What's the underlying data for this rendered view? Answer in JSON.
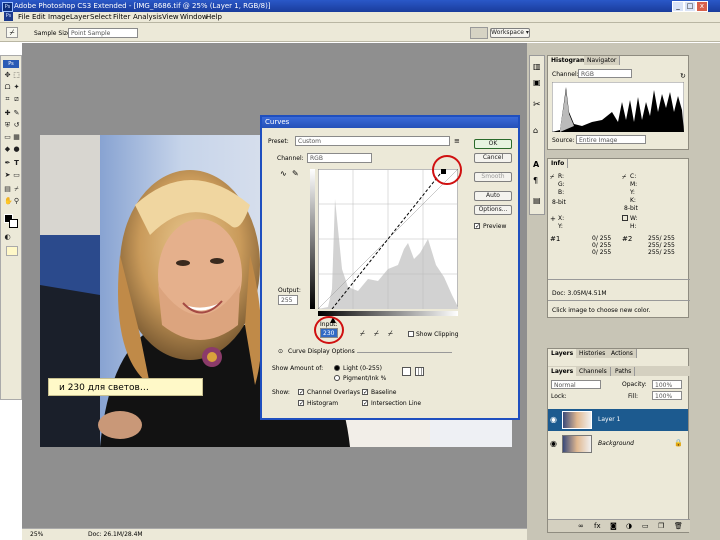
{
  "app": {
    "title": "Adobe Photoshop CS3 Extended - [IMG_8686.tif @ 25% (Layer 1, RGB/8)]",
    "icon_label": "Ps"
  },
  "window_controls": {
    "minimize": "_",
    "maximize": "□",
    "close": "x"
  },
  "menubar": {
    "items": [
      "File",
      "Edit",
      "Image",
      "Layer",
      "Select",
      "Filter",
      "Analysis",
      "View",
      "Window",
      "Help"
    ]
  },
  "options_bar": {
    "sample_size_label": "Sample Size:",
    "sample_size_value": "Point Sample",
    "workspace_label": "Workspace ▾"
  },
  "caption_box": {
    "text": "и 230 для светов…"
  },
  "curves_dialog": {
    "title": "Curves",
    "preset_label": "Preset:",
    "preset_value": "Custom",
    "channel_label": "Channel:",
    "channel_value": "RGB",
    "output_label": "Output:",
    "output_value": "255",
    "input_label": "Input:",
    "input_value": "230",
    "show_clipping_label": "Show Clipping",
    "curve_display_label": "Curve Display Options",
    "show_amount_label": "Show Amount of:",
    "light_option": "Light (0-255)",
    "pigment_option": "Pigment/Ink %",
    "show_label": "Show:",
    "show_items": [
      "Channel Overlays",
      "Baseline",
      "Histogram",
      "Intersection Line"
    ],
    "buttons": {
      "ok": "OK",
      "cancel": "Cancel",
      "smooth": "Smooth",
      "auto": "Auto",
      "options": "Options...",
      "preview": "Preview"
    }
  },
  "histogram_panel": {
    "tabs": [
      "Histogram",
      "Navigator"
    ],
    "channel_label": "Channel:",
    "channel_value": "RGB",
    "source_label": "Source:",
    "source_value": "Entire Image"
  },
  "info_panel": {
    "tab": "Info",
    "rows_left": [
      "R:",
      "G:",
      "B:",
      "8-bit"
    ],
    "rows_right": [
      "C:",
      "M:",
      "Y:",
      "K:",
      "8-bit"
    ],
    "mid_left": [
      "X:",
      "Y:"
    ],
    "mid_right": [
      "W:",
      "H:"
    ],
    "values_a": [
      "0/ 255",
      "0/ 255",
      "0/ 255"
    ],
    "values_b": [
      "255/ 255",
      "255/ 255",
      "255/ 255"
    ],
    "doc_label": "Doc: 3.05M/4.51M",
    "hint": "Click image to choose new color."
  },
  "layers_panel": {
    "tabs": [
      "Layers",
      "Channels",
      "Paths"
    ],
    "panel_tabs": [
      "Layers",
      "Histories",
      "Actions"
    ],
    "blend_mode": "Normal",
    "opacity_label": "Opacity:",
    "opacity_value": "100%",
    "lock_label": "Lock:",
    "fill_label": "Fill:",
    "fill_value": "100%",
    "layers": [
      {
        "name": "Layer 1",
        "selected": true
      },
      {
        "name": "Background",
        "selected": false
      }
    ]
  },
  "status": {
    "zoom": "25%",
    "doc": "Doc: 26.1M/28.4M"
  },
  "colors": {
    "selection": "#1c5a8f",
    "annotation_red": "#d01010",
    "title_blue": "#2450b8"
  }
}
